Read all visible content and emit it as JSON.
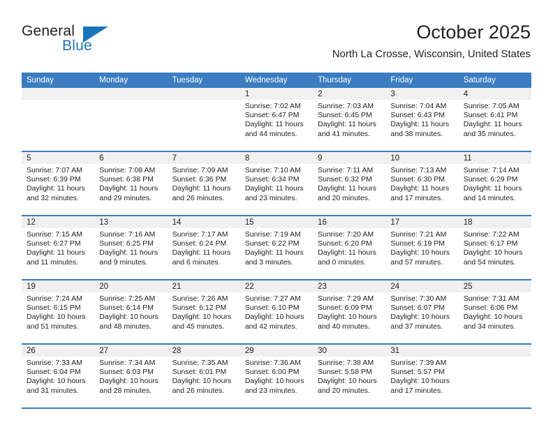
{
  "brand": {
    "name_part1": "General",
    "name_part2": "Blue",
    "logo_icon": "triangle-flag-icon"
  },
  "header": {
    "title": "October 2025",
    "location": "North La Crosse, Wisconsin, United States"
  },
  "colors": {
    "header_blue": "#3b7dc0",
    "brand_blue": "#1b75bb",
    "date_band_gray": "#f0f0f0",
    "text": "#222222"
  },
  "weekday_headers": [
    "Sunday",
    "Monday",
    "Tuesday",
    "Wednesday",
    "Thursday",
    "Friday",
    "Saturday"
  ],
  "labels": {
    "sunrise_prefix": "Sunrise:",
    "sunset_prefix": "Sunset:",
    "daylight_prefix": "Daylight:"
  },
  "weeks": [
    [
      {
        "date": "",
        "empty": true,
        "sunrise": "",
        "sunset": "",
        "daylight_line1": "",
        "daylight_line2": ""
      },
      {
        "date": "",
        "empty": true,
        "sunrise": "",
        "sunset": "",
        "daylight_line1": "",
        "daylight_line2": ""
      },
      {
        "date": "",
        "empty": true,
        "sunrise": "",
        "sunset": "",
        "daylight_line1": "",
        "daylight_line2": ""
      },
      {
        "date": "1",
        "empty": false,
        "sunrise": "Sunrise: 7:02 AM",
        "sunset": "Sunset: 6:47 PM",
        "daylight_line1": "Daylight: 11 hours",
        "daylight_line2": "and 44 minutes."
      },
      {
        "date": "2",
        "empty": false,
        "sunrise": "Sunrise: 7:03 AM",
        "sunset": "Sunset: 6:45 PM",
        "daylight_line1": "Daylight: 11 hours",
        "daylight_line2": "and 41 minutes."
      },
      {
        "date": "3",
        "empty": false,
        "sunrise": "Sunrise: 7:04 AM",
        "sunset": "Sunset: 6:43 PM",
        "daylight_line1": "Daylight: 11 hours",
        "daylight_line2": "and 38 minutes."
      },
      {
        "date": "4",
        "empty": false,
        "sunrise": "Sunrise: 7:05 AM",
        "sunset": "Sunset: 6:41 PM",
        "daylight_line1": "Daylight: 11 hours",
        "daylight_line2": "and 35 minutes."
      }
    ],
    [
      {
        "date": "5",
        "empty": false,
        "sunrise": "Sunrise: 7:07 AM",
        "sunset": "Sunset: 6:39 PM",
        "daylight_line1": "Daylight: 11 hours",
        "daylight_line2": "and 32 minutes."
      },
      {
        "date": "6",
        "empty": false,
        "sunrise": "Sunrise: 7:08 AM",
        "sunset": "Sunset: 6:38 PM",
        "daylight_line1": "Daylight: 11 hours",
        "daylight_line2": "and 29 minutes."
      },
      {
        "date": "7",
        "empty": false,
        "sunrise": "Sunrise: 7:09 AM",
        "sunset": "Sunset: 6:36 PM",
        "daylight_line1": "Daylight: 11 hours",
        "daylight_line2": "and 26 minutes."
      },
      {
        "date": "8",
        "empty": false,
        "sunrise": "Sunrise: 7:10 AM",
        "sunset": "Sunset: 6:34 PM",
        "daylight_line1": "Daylight: 11 hours",
        "daylight_line2": "and 23 minutes."
      },
      {
        "date": "9",
        "empty": false,
        "sunrise": "Sunrise: 7:11 AM",
        "sunset": "Sunset: 6:32 PM",
        "daylight_line1": "Daylight: 11 hours",
        "daylight_line2": "and 20 minutes."
      },
      {
        "date": "10",
        "empty": false,
        "sunrise": "Sunrise: 7:13 AM",
        "sunset": "Sunset: 6:30 PM",
        "daylight_line1": "Daylight: 11 hours",
        "daylight_line2": "and 17 minutes."
      },
      {
        "date": "11",
        "empty": false,
        "sunrise": "Sunrise: 7:14 AM",
        "sunset": "Sunset: 6:29 PM",
        "daylight_line1": "Daylight: 11 hours",
        "daylight_line2": "and 14 minutes."
      }
    ],
    [
      {
        "date": "12",
        "empty": false,
        "sunrise": "Sunrise: 7:15 AM",
        "sunset": "Sunset: 6:27 PM",
        "daylight_line1": "Daylight: 11 hours",
        "daylight_line2": "and 11 minutes."
      },
      {
        "date": "13",
        "empty": false,
        "sunrise": "Sunrise: 7:16 AM",
        "sunset": "Sunset: 6:25 PM",
        "daylight_line1": "Daylight: 11 hours",
        "daylight_line2": "and 9 minutes."
      },
      {
        "date": "14",
        "empty": false,
        "sunrise": "Sunrise: 7:17 AM",
        "sunset": "Sunset: 6:24 PM",
        "daylight_line1": "Daylight: 11 hours",
        "daylight_line2": "and 6 minutes."
      },
      {
        "date": "15",
        "empty": false,
        "sunrise": "Sunrise: 7:19 AM",
        "sunset": "Sunset: 6:22 PM",
        "daylight_line1": "Daylight: 11 hours",
        "daylight_line2": "and 3 minutes."
      },
      {
        "date": "16",
        "empty": false,
        "sunrise": "Sunrise: 7:20 AM",
        "sunset": "Sunset: 6:20 PM",
        "daylight_line1": "Daylight: 11 hours",
        "daylight_line2": "and 0 minutes."
      },
      {
        "date": "17",
        "empty": false,
        "sunrise": "Sunrise: 7:21 AM",
        "sunset": "Sunset: 6:19 PM",
        "daylight_line1": "Daylight: 10 hours",
        "daylight_line2": "and 57 minutes."
      },
      {
        "date": "18",
        "empty": false,
        "sunrise": "Sunrise: 7:22 AM",
        "sunset": "Sunset: 6:17 PM",
        "daylight_line1": "Daylight: 10 hours",
        "daylight_line2": "and 54 minutes."
      }
    ],
    [
      {
        "date": "19",
        "empty": false,
        "sunrise": "Sunrise: 7:24 AM",
        "sunset": "Sunset: 6:15 PM",
        "daylight_line1": "Daylight: 10 hours",
        "daylight_line2": "and 51 minutes."
      },
      {
        "date": "20",
        "empty": false,
        "sunrise": "Sunrise: 7:25 AM",
        "sunset": "Sunset: 6:14 PM",
        "daylight_line1": "Daylight: 10 hours",
        "daylight_line2": "and 48 minutes."
      },
      {
        "date": "21",
        "empty": false,
        "sunrise": "Sunrise: 7:26 AM",
        "sunset": "Sunset: 6:12 PM",
        "daylight_line1": "Daylight: 10 hours",
        "daylight_line2": "and 45 minutes."
      },
      {
        "date": "22",
        "empty": false,
        "sunrise": "Sunrise: 7:27 AM",
        "sunset": "Sunset: 6:10 PM",
        "daylight_line1": "Daylight: 10 hours",
        "daylight_line2": "and 42 minutes."
      },
      {
        "date": "23",
        "empty": false,
        "sunrise": "Sunrise: 7:29 AM",
        "sunset": "Sunset: 6:09 PM",
        "daylight_line1": "Daylight: 10 hours",
        "daylight_line2": "and 40 minutes."
      },
      {
        "date": "24",
        "empty": false,
        "sunrise": "Sunrise: 7:30 AM",
        "sunset": "Sunset: 6:07 PM",
        "daylight_line1": "Daylight: 10 hours",
        "daylight_line2": "and 37 minutes."
      },
      {
        "date": "25",
        "empty": false,
        "sunrise": "Sunrise: 7:31 AM",
        "sunset": "Sunset: 6:06 PM",
        "daylight_line1": "Daylight: 10 hours",
        "daylight_line2": "and 34 minutes."
      }
    ],
    [
      {
        "date": "26",
        "empty": false,
        "sunrise": "Sunrise: 7:33 AM",
        "sunset": "Sunset: 6:04 PM",
        "daylight_line1": "Daylight: 10 hours",
        "daylight_line2": "and 31 minutes."
      },
      {
        "date": "27",
        "empty": false,
        "sunrise": "Sunrise: 7:34 AM",
        "sunset": "Sunset: 6:03 PM",
        "daylight_line1": "Daylight: 10 hours",
        "daylight_line2": "and 28 minutes."
      },
      {
        "date": "28",
        "empty": false,
        "sunrise": "Sunrise: 7:35 AM",
        "sunset": "Sunset: 6:01 PM",
        "daylight_line1": "Daylight: 10 hours",
        "daylight_line2": "and 26 minutes."
      },
      {
        "date": "29",
        "empty": false,
        "sunrise": "Sunrise: 7:36 AM",
        "sunset": "Sunset: 6:00 PM",
        "daylight_line1": "Daylight: 10 hours",
        "daylight_line2": "and 23 minutes."
      },
      {
        "date": "30",
        "empty": false,
        "sunrise": "Sunrise: 7:38 AM",
        "sunset": "Sunset: 5:58 PM",
        "daylight_line1": "Daylight: 10 hours",
        "daylight_line2": "and 20 minutes."
      },
      {
        "date": "31",
        "empty": false,
        "sunrise": "Sunrise: 7:39 AM",
        "sunset": "Sunset: 5:57 PM",
        "daylight_line1": "Daylight: 10 hours",
        "daylight_line2": "and 17 minutes."
      },
      {
        "date": "",
        "empty": true,
        "sunrise": "",
        "sunset": "",
        "daylight_line1": "",
        "daylight_line2": ""
      }
    ]
  ]
}
